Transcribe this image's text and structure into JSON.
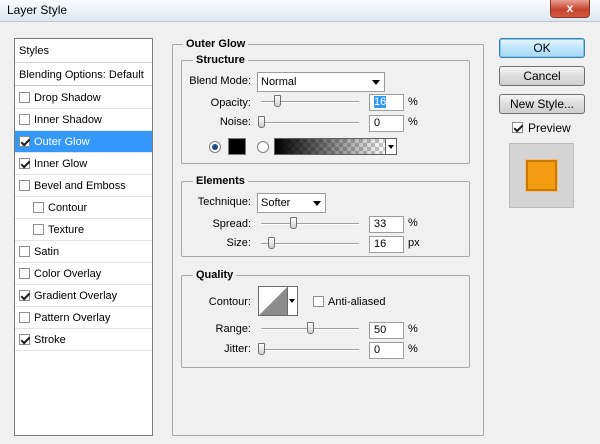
{
  "window": {
    "title": "Layer Style",
    "close_glyph": "x"
  },
  "styles_panel": {
    "header": "Styles",
    "blending": "Blending Options: Default",
    "items": [
      {
        "label": "Drop Shadow",
        "checked": false
      },
      {
        "label": "Inner Shadow",
        "checked": false
      },
      {
        "label": "Outer Glow",
        "checked": true,
        "active": true
      },
      {
        "label": "Inner Glow",
        "checked": true
      },
      {
        "label": "Bevel and Emboss",
        "checked": false
      },
      {
        "label": "Contour",
        "checked": false,
        "indent": true
      },
      {
        "label": "Texture",
        "checked": false,
        "indent": true
      },
      {
        "label": "Satin",
        "checked": false
      },
      {
        "label": "Color Overlay",
        "checked": false
      },
      {
        "label": "Gradient Overlay",
        "checked": true
      },
      {
        "label": "Pattern Overlay",
        "checked": false
      },
      {
        "label": "Stroke",
        "checked": true
      }
    ]
  },
  "outer_glow": {
    "title": "Outer Glow",
    "structure": {
      "title": "Structure",
      "blend_mode_label": "Blend Mode:",
      "blend_mode_value": "Normal",
      "opacity_label": "Opacity:",
      "opacity_value": "16",
      "noise_label": "Noise:",
      "noise_value": "0",
      "percent": "%",
      "color_swatch": "#000000",
      "solid_selected": true
    },
    "elements": {
      "title": "Elements",
      "technique_label": "Technique:",
      "technique_value": "Softer",
      "spread_label": "Spread:",
      "spread_value": "33",
      "size_label": "Size:",
      "size_value": "16",
      "percent": "%",
      "px": "px"
    },
    "quality": {
      "title": "Quality",
      "contour_label": "Contour:",
      "anti_aliased_label": "Anti-aliased",
      "anti_aliased": false,
      "range_label": "Range:",
      "range_value": "50",
      "jitter_label": "Jitter:",
      "jitter_value": "0",
      "percent": "%"
    }
  },
  "buttons": {
    "ok": "OK",
    "cancel": "Cancel",
    "new_style": "New Style...",
    "preview_label": "Preview",
    "preview_checked": true
  },
  "colors": {
    "accent": "#3399ff",
    "preview_fill": "#f39c12"
  }
}
